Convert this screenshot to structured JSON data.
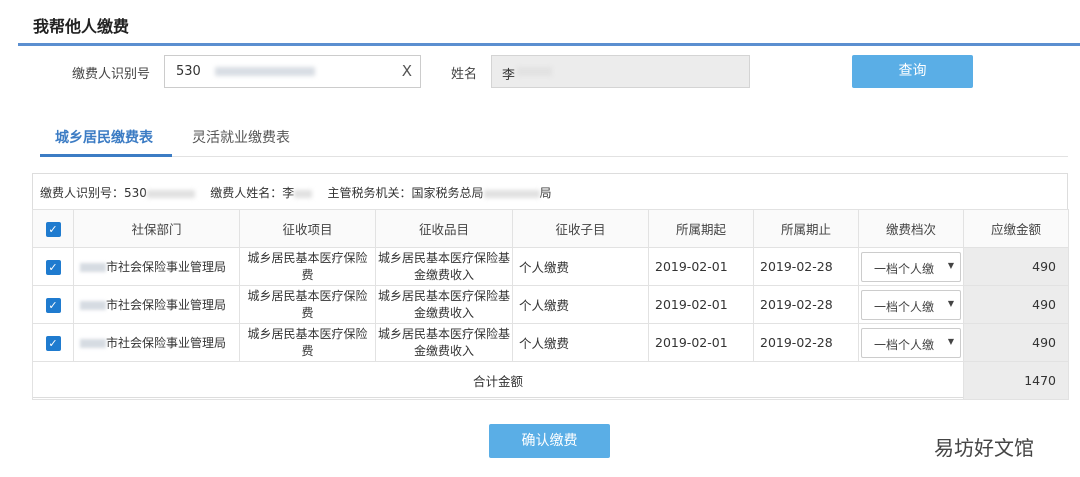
{
  "header": {
    "title": "我帮他人缴费"
  },
  "search": {
    "id_label": "缴费人识别号",
    "id_value": "530",
    "clear_icon": "X",
    "name_label": "姓名",
    "name_value": "李",
    "query_button": "查询"
  },
  "tabs": [
    {
      "label": "城乡居民缴费表",
      "active": true
    },
    {
      "label": "灵活就业缴费表",
      "active": false
    }
  ],
  "info": {
    "id_label": "缴费人识别号：",
    "id_value": "530",
    "name_label": "缴费人姓名：",
    "name_value": "李",
    "authority_label": "主管税务机关：",
    "authority_value": "国家税务总局",
    "authority_suffix": "局"
  },
  "table": {
    "columns": [
      "社保部门",
      "征收项目",
      "征收品目",
      "征收子目",
      "所属期起",
      "所属期止",
      "缴费档次",
      "应缴金额"
    ],
    "rows": [
      {
        "dept": "市社会保险事业管理局",
        "project": "城乡居民基本医疗保险费",
        "item": "城乡居民基本医疗保险基金缴费收入",
        "subitem": "个人缴费",
        "start": "2019-02-01",
        "end": "2019-02-28",
        "level": "一档个人缴",
        "amount": "490"
      },
      {
        "dept": "市社会保险事业管理局",
        "project": "城乡居民基本医疗保险费",
        "item": "城乡居民基本医疗保险基金缴费收入",
        "subitem": "个人缴费",
        "start": "2019-02-01",
        "end": "2019-02-28",
        "level": "一档个人缴",
        "amount": "490"
      },
      {
        "dept": "市社会保险事业管理局",
        "project": "城乡居民基本医疗保险费",
        "item": "城乡居民基本医疗保险基金缴费收入",
        "subitem": "个人缴费",
        "start": "2019-02-01",
        "end": "2019-02-28",
        "level": "一档个人缴",
        "amount": "490"
      }
    ],
    "total_label": "合计金额",
    "total_value": "1470"
  },
  "confirm_button": "确认缴费",
  "watermark": "易坊好文馆",
  "colors": {
    "accent": "#3c7cc4",
    "button": "#5aaee6",
    "checkbox": "#1f7bcf"
  }
}
